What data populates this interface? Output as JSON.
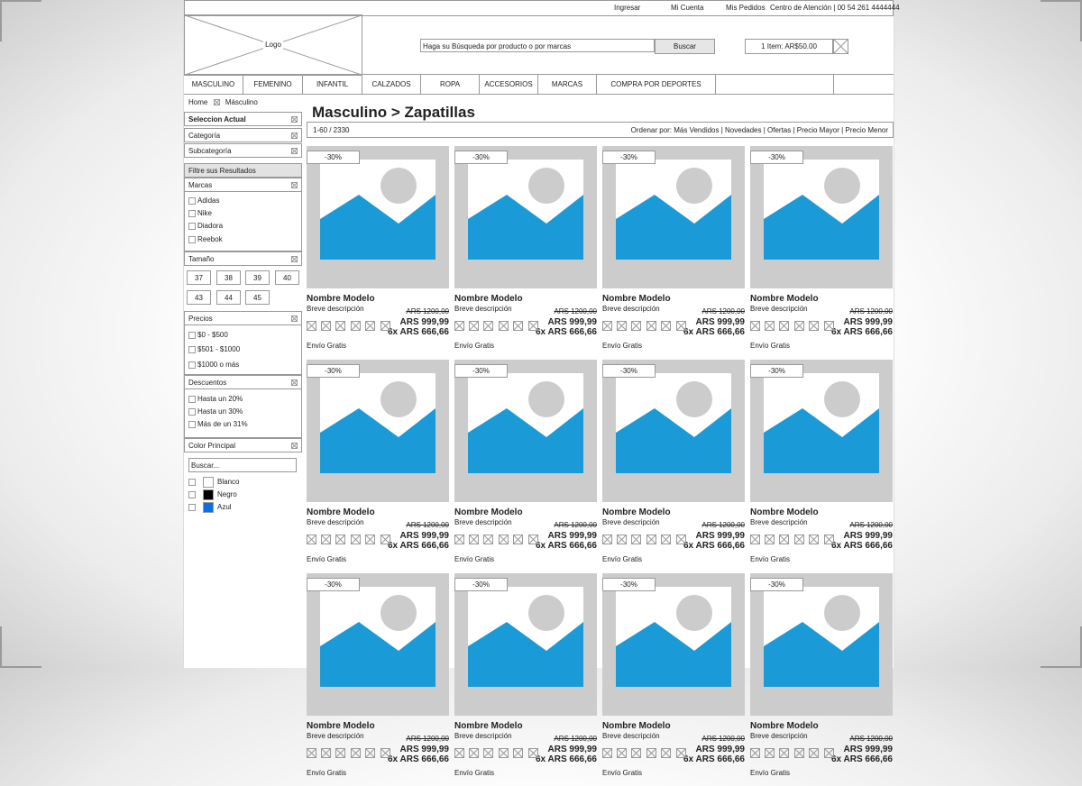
{
  "topbar": {
    "login": "Ingresar",
    "account": "Mi Cuenta",
    "orders": "Mis Pedidos",
    "support": "Centro de Atención | 00 54 261 4444444"
  },
  "header": {
    "logo": "Logo",
    "search_placeholder": "Haga su Búsqueda por producto o por marcas",
    "search_button": "Buscar",
    "cart": "1 Item: AR$50.00"
  },
  "nav": [
    "MASCULINO",
    "FEMENINO",
    "INFANTIL",
    "CALZADOS",
    "ROPA",
    "ACCESORIOS",
    "MARCAS",
    "COMPRA POR DEPORTES"
  ],
  "breadcrumb": [
    "Home",
    "Másculino"
  ],
  "sidebar": {
    "current": "Seleccion Actual",
    "category": "Categoría",
    "subcategory": "Subcategoría",
    "filter_title": "Filtre sus Resultados",
    "brands_title": "Marcas",
    "brands": [
      "Adidas",
      "Nike",
      "Diadora",
      "Reebok"
    ],
    "size_title": "Tamaño",
    "sizes": [
      "37",
      "38",
      "39",
      "40",
      "43",
      "44",
      "45"
    ],
    "price_title": "Precios",
    "prices": [
      "$0 - $500",
      "$501 - $1000",
      "$1000 o más"
    ],
    "discount_title": "Descuentos",
    "discounts": [
      "Hasta un 20%",
      "Hasta un 30%",
      "Más de un 31%"
    ],
    "color_title": "Color Principal",
    "color_search": "Buscar...",
    "colors": [
      {
        "name": "Blanco",
        "hex": "#ffffff"
      },
      {
        "name": "Negro",
        "hex": "#000000"
      },
      {
        "name": "Azul",
        "hex": "#0a6ee6"
      }
    ]
  },
  "main": {
    "title": "Masculino > Zapatillas",
    "count": "1-60 / 2330",
    "sort": "Ordenar por: Más Vendidos | Novedades | Ofertas | Precio Mayor | Precio Menor"
  },
  "product": {
    "discount": "-30%",
    "name": "Nombre Modelo",
    "desc": "Breve descripción",
    "old_price": "ARS 1200,00",
    "price": "ARS 999,99",
    "installments": "6x ARS 666,66",
    "shipping": "Envío Gratis"
  },
  "colors": {
    "image_bg": "#cccccc",
    "image_blue": "#1a9bd7",
    "sun": "#cccccc"
  }
}
